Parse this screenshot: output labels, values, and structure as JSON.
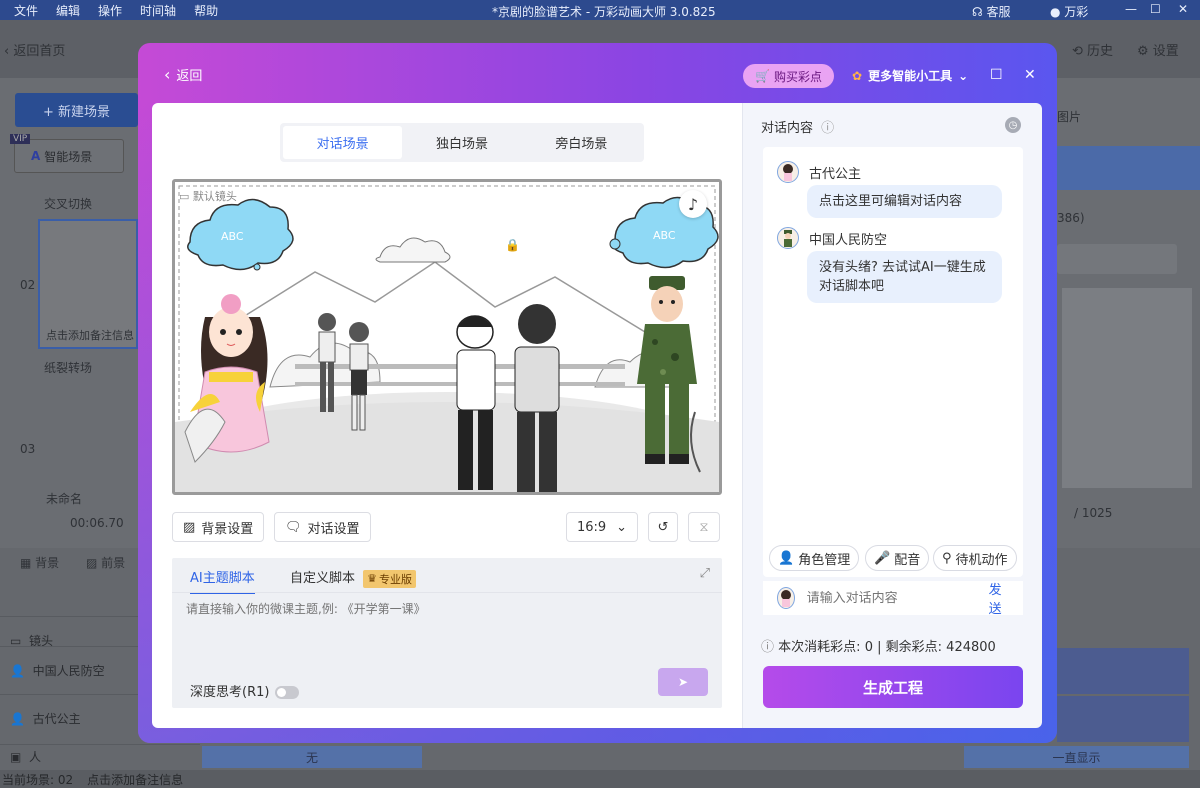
{
  "app": {
    "title": "*京剧的脸谱艺术 - 万彩动画大师 3.0.825",
    "menu": [
      "文件",
      "编辑",
      "操作",
      "时间轴",
      "帮助"
    ],
    "service": "客服",
    "user": "万彩",
    "back_home": "返回首页",
    "history": "历史",
    "settings": "设置",
    "new_scene": "+ 新建场景",
    "smart_scene": "智能场景",
    "transition1": "交叉切换",
    "transition2": "纸裂转场",
    "scene_no_2": "02",
    "scene_no_3": "03",
    "scene_note": "点击添加备注信息",
    "scene_unnamed": "未命名",
    "scene_time": "00:06.70",
    "bg_tab": "背景",
    "fg_tab": "前景",
    "track_camera": "镜头",
    "track_defense": "中国人民防空",
    "track_princess": "古代公主",
    "track_person": "人",
    "right_img": "图片",
    "right_count": "386)",
    "pager": "/ 1025",
    "timeline_none": "无",
    "timeline_always": "一直显示",
    "status_scene": "当前场景: 02",
    "status_note": "点击添加备注信息"
  },
  "modal": {
    "back": "返回",
    "buy": "购买彩点",
    "more_tools": "更多智能小工具",
    "tabs": [
      "对话场景",
      "独白场景",
      "旁白场景"
    ],
    "active_tab": 0,
    "default_camera": "默认镜头",
    "bg_settings": "背景设置",
    "dialog_settings": "对话设置",
    "ratio": "16:9",
    "ai_tab": "AI主题脚本",
    "custom_tab": "自定义脚本",
    "pro_badge": "专业版",
    "ai_placeholder": "请直接输入你的微课主题,例: 《开学第一课》",
    "deep_think": "深度思考(R1)",
    "dialog_title": "对话内容",
    "messages": [
      {
        "speaker": "古代公主",
        "text": "点击这里可编辑对话内容"
      },
      {
        "speaker": "中国人民防空",
        "text": "没有头绪? 去试试AI一键生成对话脚本吧"
      }
    ],
    "role_mgmt": "角色管理",
    "voice": "配音",
    "idle_action": "待机动作",
    "input_placeholder": "请输入对话内容",
    "send": "发送",
    "cost_label": "本次消耗彩点:",
    "cost_value": "0",
    "remain_label": "剩余彩点:",
    "remain_value": "424800",
    "generate": "生成工程"
  },
  "colors": {
    "accent": "#3c6ff0",
    "brand_purple": "#b54bea",
    "title_bar": "#2d4a8e"
  }
}
